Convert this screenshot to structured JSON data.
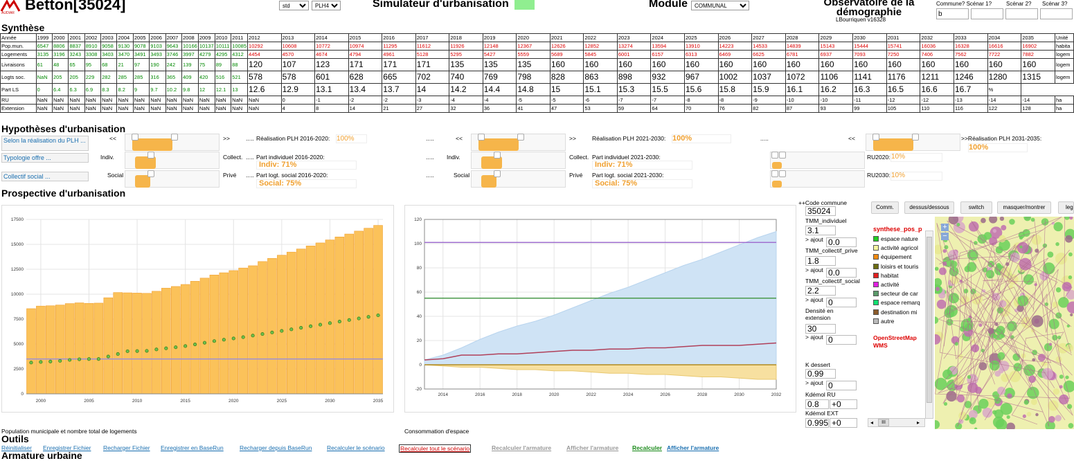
{
  "header": {
    "title": "Betton[35024]",
    "logo_text": "AUDIAR",
    "select_std": "std",
    "select_plh": "PLH4",
    "sim_title": "Simulateur d'urbanisation",
    "module_label": "Module",
    "module_select": "COMMUNAL",
    "obs_title": "Observatoire de la démographie",
    "version": "LBourriquen v16328",
    "scenarios": [
      {
        "label": "Commune? Scénar 1?",
        "value": "b"
      },
      {
        "label": "Scénar 2?",
        "value": ""
      },
      {
        "label": "Scénar 3?",
        "value": ""
      }
    ]
  },
  "synthese": {
    "heading": "Synthèse",
    "years": [
      "1999",
      "2000",
      "2001",
      "2002",
      "2003",
      "2004",
      "2005",
      "2006",
      "2007",
      "2008",
      "2009",
      "2010",
      "2011",
      "2012",
      "2013",
      "2014",
      "2015",
      "2016",
      "2017",
      "2018",
      "2019",
      "2020",
      "2021",
      "2022",
      "2023",
      "2024",
      "2025",
      "2026",
      "2027",
      "2028",
      "2029",
      "2030",
      "2031",
      "2032",
      "2033",
      "2034",
      "2035"
    ],
    "header_label": "Année",
    "unit_header": "Unité",
    "rows": [
      {
        "label": "Pop.mun.",
        "unit": "habita",
        "cls": "small",
        "values": [
          "6547",
          "8806",
          "8837",
          "8910",
          "9058",
          "9130",
          "9078",
          "9103",
          "9643",
          "10166",
          "10137",
          "10111",
          "10085",
          "10292",
          "10608",
          "10772",
          "10974",
          "11295",
          "11612",
          "11926",
          "12148",
          "12367",
          "12626",
          "12852",
          "13274",
          "13594",
          "13910",
          "14223",
          "14533",
          "14839",
          "15143",
          "15444",
          "15741",
          "16036",
          "16328",
          "16616",
          "16902"
        ]
      },
      {
        "label": "Logements",
        "unit": "logem",
        "cls": "small",
        "values": [
          "3135",
          "3196",
          "3243",
          "3308",
          "3403",
          "3470",
          "3491",
          "3493",
          "3746",
          "3997",
          "4279",
          "4295",
          "4312",
          "4454",
          "4570",
          "4674",
          "4794",
          "4961",
          "5128",
          "5295",
          "5427",
          "5559",
          "5689",
          "5845",
          "6001",
          "6157",
          "6313",
          "6469",
          "6625",
          "6781",
          "6937",
          "7093",
          "7250",
          "7406",
          "7562",
          "7722",
          "7882"
        ]
      },
      {
        "label": "Livraisons",
        "unit": "logem",
        "cls": "big",
        "values": [
          "61",
          "48",
          "65",
          "95",
          "68",
          "21",
          "97",
          "190",
          "242",
          "139",
          "75",
          "89",
          "88",
          "120",
          "107",
          "123",
          "171",
          "171",
          "171",
          "135",
          "135",
          "135",
          "160",
          "160",
          "160",
          "160",
          "160",
          "160",
          "160",
          "160",
          "160",
          "160",
          "160",
          "160",
          "160",
          "160",
          "160"
        ]
      },
      {
        "label": "Logts soc.",
        "unit": "logem",
        "cls": "big",
        "values": [
          "NaN",
          "205",
          "205",
          "229",
          "282",
          "285",
          "285",
          "316",
          "365",
          "409",
          "420",
          "516",
          "521",
          "578",
          "578",
          "601",
          "628",
          "665",
          "702",
          "740",
          "769",
          "798",
          "828",
          "863",
          "898",
          "932",
          "967",
          "1002",
          "1037",
          "1072",
          "1106",
          "1141",
          "1176",
          "1211",
          "1246",
          "1280",
          "1315"
        ]
      },
      {
        "label": "Part LS",
        "unit": "%",
        "cls": "big",
        "values": [
          "0",
          "6.4",
          "6.3",
          "6.9",
          "8.3",
          "8.2",
          "9",
          "9.7",
          "10.2",
          "9.8",
          "12",
          "12.1",
          "13",
          "12.6",
          "12.9",
          "13.1",
          "13.4",
          "13.7",
          "14",
          "14.2",
          "14.4",
          "14.8",
          "15",
          "15.1",
          "15.3",
          "15.5",
          "15.6",
          "15.8",
          "15.9",
          "16.1",
          "16.2",
          "16.3",
          "16.5",
          "16.6",
          "16.7"
        ]
      },
      {
        "label": "RU",
        "unit": "ha",
        "cls": "small",
        "values": [
          "NaN",
          "NaN",
          "NaN",
          "NaN",
          "NaN",
          "NaN",
          "NaN",
          "NaN",
          "NaN",
          "NaN",
          "NaN",
          "NaN",
          "NaN",
          "NaN",
          "0",
          "-1",
          "-2",
          "-2",
          "-3",
          "-4",
          "-4",
          "-5",
          "-5",
          "-6",
          "-7",
          "-7",
          "-8",
          "-8",
          "-9",
          "-10",
          "-10",
          "-11",
          "-12",
          "-12",
          "-13",
          "-14",
          "-14"
        ]
      },
      {
        "label": "Extension",
        "unit": "ha",
        "cls": "small",
        "values": [
          "NaN",
          "NaN",
          "NaN",
          "NaN",
          "NaN",
          "NaN",
          "NaN",
          "NaN",
          "NaN",
          "NaN",
          "NaN",
          "NaN",
          "NaN",
          "NaN",
          "4",
          "8",
          "14",
          "21",
          "27",
          "32",
          "36",
          "41",
          "47",
          "53",
          "59",
          "64",
          "70",
          "76",
          "82",
          "87",
          "93",
          "99",
          "105",
          "110",
          "116",
          "122",
          "128"
        ]
      }
    ]
  },
  "hypotheses": {
    "heading": "Hypothèses d'urbanisation",
    "btn_realisation": "Selon la réalisation du PLH ...",
    "btn_typologie": "Typologie offre ...",
    "btn_collectif": "Collectif social ...",
    "arrow_left": "<<",
    "arrow_right": ">>",
    "dots": ".....",
    "real_1620_label": "Réalisation PLH 2016-2020:",
    "real_1620_val": "100%",
    "real_2130_label": "Réalisation PLH 2021-2030:",
    "real_2130_val": "100%",
    "real_3135_label": ">>Réalisation PLH 2031-2035:",
    "real_3135_val": "100%",
    "indiv": "Indiv.",
    "collect": "Collect.",
    "social": "Social",
    "prive": "Privé",
    "pi_1620_label": "Part individuel 2016-2020:",
    "pi_1620_val": "Indiv: 71%",
    "pi_2130_label": "Part individuel 2021-2030:",
    "pi_2130_val": "Indiv: 71%",
    "ps_1620_label": "Part logt. social 2016-2020:",
    "ps_1620_val": "Social: 75%",
    "ps_2130_label": "Part logt. social 2021-2030:",
    "ps_2130_val": "Social: 75%",
    "ru2020_label": "RU2020:",
    "ru2020_val": "10%",
    "ru2030_label": "RU2030:",
    "ru2030_val": "10%"
  },
  "prospective": {
    "heading": "Prospective d'urbanisation",
    "caption1": "Population municipale et nombre total de logements",
    "caption2": "Consommation d'espace"
  },
  "chart_data": [
    {
      "type": "bar",
      "title": "Population municipale et nombre total de logements",
      "x": [
        1999,
        2000,
        2001,
        2002,
        2003,
        2004,
        2005,
        2006,
        2007,
        2008,
        2009,
        2010,
        2011,
        2012,
        2013,
        2014,
        2015,
        2016,
        2017,
        2018,
        2019,
        2020,
        2021,
        2022,
        2023,
        2024,
        2025,
        2026,
        2027,
        2028,
        2029,
        2030,
        2031,
        2032,
        2033,
        2034,
        2035
      ],
      "series": [
        {
          "values": [
            8547,
            8806,
            8837,
            8910,
            9058,
            9130,
            9078,
            9103,
            9643,
            10166,
            10137,
            10111,
            10085,
            10292,
            10608,
            10772,
            10974,
            11295,
            11612,
            11926,
            12148,
            12367,
            12626,
            12852,
            13274,
            13594,
            13910,
            14223,
            14533,
            14839,
            15143,
            15444,
            15741,
            16036,
            16328,
            16616,
            16902
          ],
          "color": "#fbc25a"
        },
        {
          "values": [
            3135,
            3196,
            3243,
            3308,
            3403,
            3470,
            3491,
            3493,
            3746,
            3997,
            4279,
            4295,
            4312,
            4454,
            4570,
            4674,
            4794,
            4961,
            5128,
            5295,
            5427,
            5559,
            5689,
            5845,
            6001,
            6157,
            6313,
            6469,
            6625,
            6781,
            6937,
            7093,
            7250,
            7406,
            7562,
            7722,
            7882
          ],
          "color": "#3a9a2a"
        }
      ],
      "hline": 3500,
      "hline_color": "#9b8fd6",
      "xticks": [
        2000,
        2005,
        2010,
        2015,
        2020,
        2025,
        2030,
        2035
      ],
      "yticks": [
        0,
        2500,
        5000,
        7500,
        10000,
        12500,
        15000,
        17500
      ],
      "ylim": [
        0,
        17500
      ],
      "grid": true
    },
    {
      "type": "area",
      "title": "Consommation d'espace",
      "x": [
        2013,
        2014,
        2015,
        2016,
        2017,
        2018,
        2019,
        2020,
        2021,
        2022,
        2023,
        2024,
        2025,
        2026,
        2027,
        2028,
        2029,
        2030,
        2031,
        2032
      ],
      "series": [
        {
          "values": [
            4,
            8,
            14,
            21,
            27,
            32,
            36,
            41,
            47,
            53,
            59,
            64,
            70,
            76,
            82,
            87,
            93,
            99,
            105,
            110
          ],
          "color": "#cfe3f5"
        },
        {
          "values": [
            4,
            5,
            8,
            8,
            9,
            9,
            10,
            11,
            12,
            12,
            13,
            13,
            14,
            14,
            15,
            16,
            16,
            16,
            17,
            18
          ],
          "color": "#b0405a"
        },
        {
          "values": [
            0,
            -1,
            -2,
            -2,
            -3,
            -4,
            -4,
            -5,
            -5,
            -6,
            -7,
            -7,
            -8,
            -8,
            -9,
            -10,
            -10,
            -11,
            -12,
            -12
          ],
          "color": "#f7e0a0"
        }
      ],
      "hlines": [
        {
          "value": 101,
          "color": "#a070d0"
        },
        {
          "value": 55,
          "color": "#4a9a4a"
        }
      ],
      "xticks": [
        2014,
        2016,
        2018,
        2020,
        2022,
        2024,
        2026,
        2028,
        2030,
        2032
      ],
      "yticks": [
        -20,
        0,
        20,
        40,
        60,
        80,
        100,
        120
      ],
      "ylim": [
        -20,
        120
      ],
      "grid": true
    }
  ],
  "side": {
    "code_label": "++Code commune",
    "code_val": "35024",
    "tmm_ind_label": "TMM_individuel",
    "tmm_ind_val": "3.1",
    "tmm_cp_label": "TMM_collectif_prive",
    "tmm_cp_val": "1.8",
    "tmm_cs_label": "TMM_collectif_social",
    "tmm_cs_val": "2.2",
    "ajout_label": "> ajout",
    "ajout_val1": "0.0",
    "ajout_val2": "0.0",
    "ajout_val3": "0",
    "dens_label": "Densité en extension",
    "dens_val": "30",
    "ajout_val4": "0",
    "kdess_label": "K dessert",
    "kdess_val": "0.99",
    "ajout_val5": "0",
    "kdemol_ru_label": "Kdémol RU",
    "kdemol_ru_val": "0.8",
    "kdemol_ru_add": "+0",
    "kdemol_ext_label": "Kdémol EXT",
    "kdemol_ext_val": "0.995",
    "kdemol_ext_add": "+0"
  },
  "map": {
    "buttons": [
      "Comm.",
      "dessus/dessous",
      "switch",
      "masquer/montrer",
      "leg"
    ],
    "legend_title": "synthese_pos_p",
    "legend": [
      {
        "label": "espace nature",
        "color": "#22cc22"
      },
      {
        "label": "activité agricol",
        "color": "#f5f5a0"
      },
      {
        "label": "équipement",
        "color": "#f08a10"
      },
      {
        "label": "loisirs et touris",
        "color": "#6b6b10"
      },
      {
        "label": "habitat",
        "color": "#e02020"
      },
      {
        "label": "activité",
        "color": "#e020e0"
      },
      {
        "label": "secteur de car",
        "color": "#5a9a6a"
      },
      {
        "label": "espace remarq",
        "color": "#10e070"
      },
      {
        "label": "destination mi",
        "color": "#8a5a2a"
      },
      {
        "label": "autre",
        "color": "#bbbbbb"
      }
    ],
    "osm": "OpenStreetMap",
    "wms": "WMS",
    "zoom_in": "+",
    "zoom_out": "−",
    "hscroll": "III"
  },
  "outils": {
    "heading": "Outils",
    "links": [
      {
        "label": "Réinitialiser",
        "color": "#1a6fb0"
      },
      {
        "label": "Enregistrer Fichier",
        "color": "#1a6fb0"
      },
      {
        "label": "Recharger Fichier",
        "color": "#1a6fb0"
      },
      {
        "label": "Enregistrer en BaseRun",
        "color": "#1a6fb0"
      },
      {
        "label": "Recharger depuis BaseRun",
        "color": "#1a6fb0"
      },
      {
        "label": "Recalculer le scénario",
        "color": "#1a6fb0"
      },
      {
        "label": "Recalculer tout le scénario",
        "color": "#d00000"
      },
      {
        "label": "Recalculer l'armature",
        "color": "#999999"
      },
      {
        "label": "Afficher l'armature",
        "color": "#999999"
      },
      {
        "label": "Recalculer",
        "color": "#1a8a1a"
      },
      {
        "label": "Afficher l'armature",
        "color": "#1a6fb0"
      }
    ]
  },
  "armature": {
    "heading": "Armature urbaine"
  }
}
